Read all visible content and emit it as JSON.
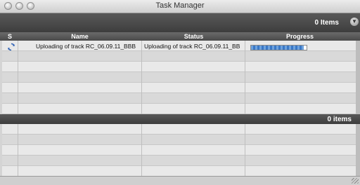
{
  "window": {
    "title": "Task Manager"
  },
  "top_panel": {
    "items_count": "0 Items",
    "columns": {
      "s": "S",
      "name": "Name",
      "status": "Status",
      "progress": "Progress"
    },
    "tasks": [
      {
        "icon": "sync-icon",
        "name": "Uploading of track RC_06.09.11_BBB",
        "status": "Uploading of track RC_06.09.11_BB",
        "progress": 0.95
      }
    ]
  },
  "bottom_panel": {
    "items_count": "0 items"
  },
  "colors": {
    "progress_fill": "#3a78c6",
    "header_dark": "#444444"
  }
}
